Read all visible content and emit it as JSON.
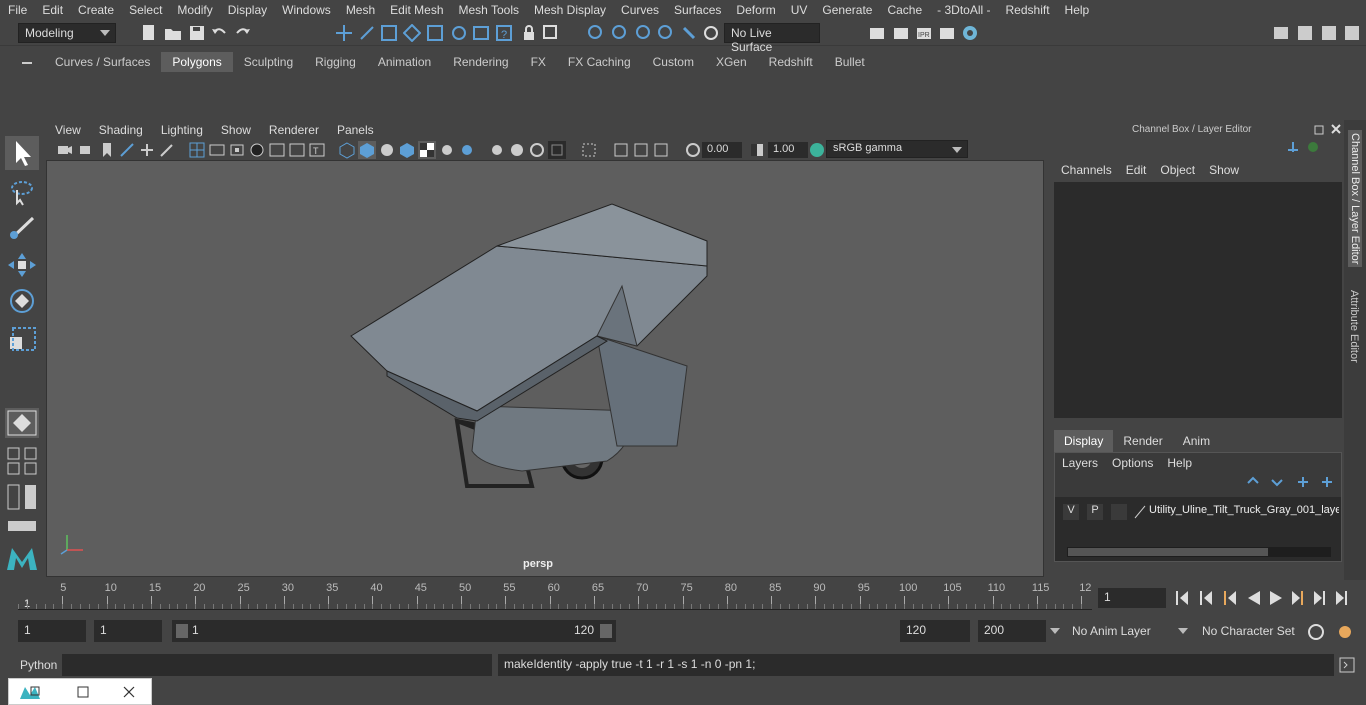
{
  "menubar": [
    "File",
    "Edit",
    "Create",
    "Select",
    "Modify",
    "Display",
    "Windows",
    "Mesh",
    "Edit Mesh",
    "Mesh Tools",
    "Mesh Display",
    "Curves",
    "Surfaces",
    "Deform",
    "UV",
    "Generate",
    "Cache",
    "- 3DtoAll -",
    "Redshift",
    "Help"
  ],
  "status": {
    "mode": "Modeling",
    "live_surface": "No Live Surface"
  },
  "shelf_tabs": [
    "Curves / Surfaces",
    "Polygons",
    "Sculpting",
    "Rigging",
    "Animation",
    "Rendering",
    "FX",
    "FX Caching",
    "Custom",
    "XGen",
    "Redshift",
    "Bullet"
  ],
  "shelf_active": "Polygons",
  "viewport": {
    "menu": [
      "View",
      "Shading",
      "Lighting",
      "Show",
      "Renderer",
      "Panels"
    ],
    "exposure": "0.00",
    "gamma": "1.00",
    "color_space": "sRGB gamma",
    "camera_label": "persp"
  },
  "channel_box": {
    "title": "Channel Box / Layer Editor",
    "menu": [
      "Channels",
      "Edit",
      "Object",
      "Show"
    ],
    "tabs": [
      "Display",
      "Render",
      "Anim"
    ],
    "active_tab": "Display",
    "layer_menu": [
      "Layers",
      "Options",
      "Help"
    ],
    "layer": {
      "v": "V",
      "p": "P",
      "name": "Utility_Uline_Tilt_Truck_Gray_001_laye"
    }
  },
  "side_tabs": [
    "Channel Box / Layer Editor",
    "Attribute Editor"
  ],
  "timeline": {
    "ticks": [
      "5",
      "10",
      "15",
      "20",
      "25",
      "30",
      "35",
      "40",
      "45",
      "50",
      "55",
      "60",
      "65",
      "70",
      "75",
      "80",
      "85",
      "90",
      "95",
      "100",
      "105",
      "110",
      "115",
      "12"
    ],
    "start_marker": "1",
    "current_frame": "1"
  },
  "range": {
    "start": "1",
    "inner_start": "1",
    "slider_start": "1",
    "slider_end": "120",
    "end": "120",
    "outer_end": "200",
    "anim_layer": "No Anim Layer",
    "char_set": "No Character Set"
  },
  "cmdline": {
    "lang": "Python",
    "result": "makeIdentity -apply true -t 1 -r 1 -s 1 -n 0 -pn 1;"
  },
  "colors": {
    "bg": "#444444",
    "viewport": "#5e5e5e",
    "accent": "#5d9fd6",
    "shelf_orange": "#e8a85c",
    "shelf_green": "#3cb39b"
  }
}
